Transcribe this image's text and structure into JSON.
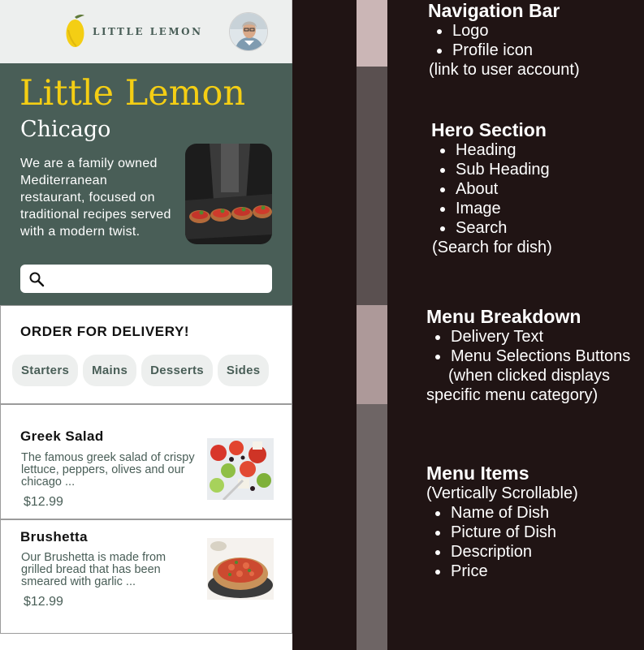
{
  "nav": {
    "logo_text": "LITTLE LEMON",
    "profile_alt": "Profile icon"
  },
  "hero": {
    "title": "Little Lemon",
    "subtitle": "Chicago",
    "about": "We are a family owned Mediterranean restaurant, focused on traditional recipes served with a modern twist.",
    "search_placeholder": ""
  },
  "breakdown": {
    "delivery_text": "ORDER FOR DELIVERY!",
    "categories": [
      "Starters",
      "Mains",
      "Desserts",
      "Sides"
    ]
  },
  "menu_items": [
    {
      "name": "Greek Salad",
      "description": "The famous greek salad of crispy lettuce, peppers, olives and our chicago ...",
      "price": "$12.99"
    },
    {
      "name": "Brushetta",
      "description": "Our Brushetta is made from grilled bread that has been smeared with garlic ...",
      "price": "$12.99"
    }
  ],
  "annotations": {
    "nav": {
      "heading": "Navigation Bar",
      "bullets": [
        "Logo",
        "Profile icon"
      ],
      "note": "(link to user account)"
    },
    "hero": {
      "heading": "Hero Section",
      "bullets": [
        "Heading",
        "Sub Heading",
        "About",
        "Image",
        "Search"
      ],
      "note": "(Search for dish)"
    },
    "breakdown": {
      "heading": "Menu Breakdown",
      "bullets": [
        "Delivery Text",
        "Menu Selections Buttons"
      ],
      "note1": "(when clicked displays",
      "note2": "specific menu category)"
    },
    "items": {
      "heading": "Menu Items",
      "note": "(Vertically Scrollable)",
      "bullets": [
        "Name of Dish",
        "Picture of Dish",
        "Description",
        "Price"
      ]
    }
  },
  "colors": {
    "primary_green": "#495e57",
    "primary_yellow": "#f4ce14",
    "background_dark": "#201414",
    "light_gray": "#edefee"
  }
}
